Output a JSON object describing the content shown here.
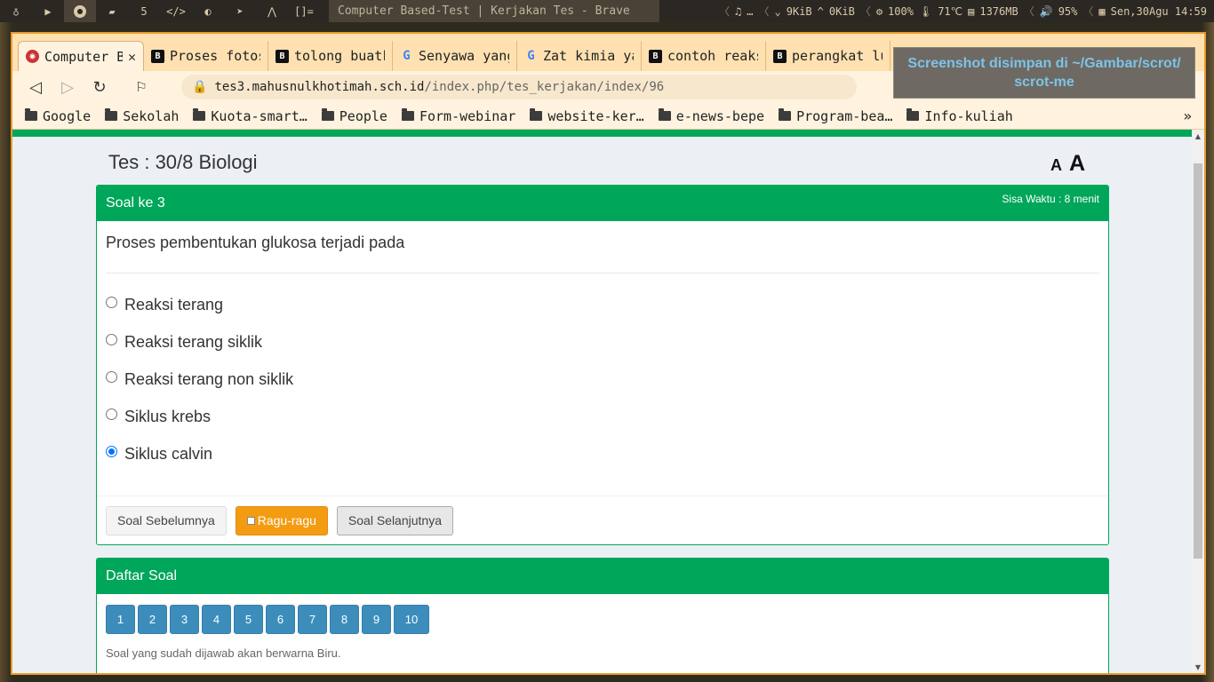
{
  "system_bar": {
    "workspace_label": "5",
    "brackets_label": "[]=",
    "window_title": "Computer Based-Test | Kerjakan Tes - Brave",
    "music": "…",
    "net_down": "9KiB",
    "net_up": "0KiB",
    "cpu": "100%",
    "temp": "71℃",
    "ram": "1376MB",
    "volume": "95%",
    "datetime": "Sen,30Agu 14:59"
  },
  "tabs": [
    {
      "label": "Computer Based-Test",
      "icon": "cbt-icon",
      "active": true
    },
    {
      "label": "Proses fotosintesis",
      "icon": "b-icon"
    },
    {
      "label": "tolong buatkan",
      "icon": "b-icon"
    },
    {
      "label": "Senyawa yang",
      "icon": "google-icon"
    },
    {
      "label": "Zat kimia yang",
      "icon": "google-icon"
    },
    {
      "label": "contoh reaksi",
      "icon": "b-icon"
    },
    {
      "label": "perangkat lunak",
      "icon": "b-icon"
    }
  ],
  "address_bar": {
    "host": "tes3.mahusnulkhotimah.sch.id",
    "path": "/index.php/tes_kerjakan/index/96"
  },
  "bookmarks": [
    "Google",
    "Sekolah",
    "Kuota-smart…",
    "People",
    "Form-webinar",
    "website-ker…",
    "e-news-bepe",
    "Program-bea…",
    "Info-kuliah"
  ],
  "bookmarks_more": "»",
  "notification": {
    "line1": "Screenshot disimpan di ~/Gambar/scrot/",
    "line2": "scrot-me"
  },
  "page": {
    "title": "Tes : 30/8 Biologi",
    "font_small": "A",
    "font_large": "A",
    "question_box": {
      "header": "Soal ke 3",
      "timer": "Sisa Waktu : 8 menit",
      "question": "Proses pembentukan glukosa terjadi pada",
      "options": [
        {
          "label": "Reaksi terang",
          "checked": false
        },
        {
          "label": "Reaksi terang siklik",
          "checked": false
        },
        {
          "label": "Reaksi terang non siklik",
          "checked": false
        },
        {
          "label": "Siklus krebs",
          "checked": false
        },
        {
          "label": "Siklus calvin",
          "checked": true
        }
      ],
      "prev_button": "Soal Sebelumnya",
      "doubt_button": "Ragu-ragu",
      "next_button": "Soal Selanjutnya"
    },
    "question_list": {
      "header": "Daftar Soal",
      "numbers": [
        "1",
        "2",
        "3",
        "4",
        "5",
        "6",
        "7",
        "8",
        "9",
        "10"
      ],
      "hint": "Soal yang sudah dijawab akan berwarna Biru."
    }
  },
  "colors": {
    "primary_green": "#00a65a",
    "number_blue": "#3c8dbc",
    "warning_orange": "#f39c12",
    "browser_frame": "#ffe1b1"
  }
}
